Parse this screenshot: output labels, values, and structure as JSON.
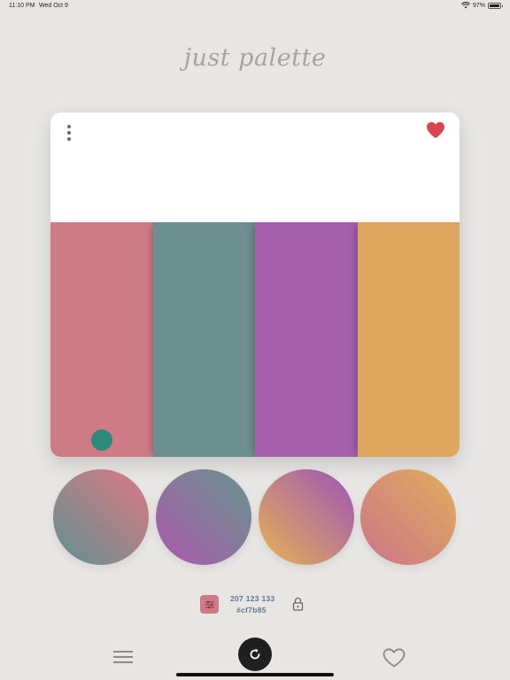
{
  "status": {
    "time": "11:10 PM",
    "date": "Wed Oct 9",
    "battery": "97%",
    "battery_level": 0.97,
    "icons": [
      "wifi-icon",
      "battery-icon"
    ]
  },
  "app": {
    "title": "just palette"
  },
  "palette": {
    "favorited": true,
    "swatches": [
      {
        "name": "swatch-1",
        "color": "#cf7b85"
      },
      {
        "name": "swatch-2",
        "color": "#6e8f90"
      },
      {
        "name": "swatch-3",
        "color": "#a55fab"
      },
      {
        "name": "swatch-4",
        "color": "#dea760"
      }
    ],
    "picker_dot_color": "#2e8a7c"
  },
  "gradients": [
    {
      "from": "#cf7b85",
      "to": "#6e8f90"
    },
    {
      "from": "#6e8f90",
      "to": "#a55fab"
    },
    {
      "from": "#a55fab",
      "to": "#dea760"
    },
    {
      "from": "#dea760",
      "to": "#cf7b85"
    }
  ],
  "selected_color": {
    "rgb": "207 123 133",
    "hex": "#cf7b85"
  },
  "colors": {
    "background": "#e7e6e4",
    "title": "#a4a4a4",
    "heart": "#d9454f",
    "info_text": "#5e7690",
    "refresh_button": "#1f1f1f"
  },
  "icons": [
    "more-vertical-icon",
    "heart-filled-icon",
    "sliders-icon",
    "lock-icon",
    "menu-icon",
    "refresh-icon",
    "heart-outline-icon"
  ]
}
